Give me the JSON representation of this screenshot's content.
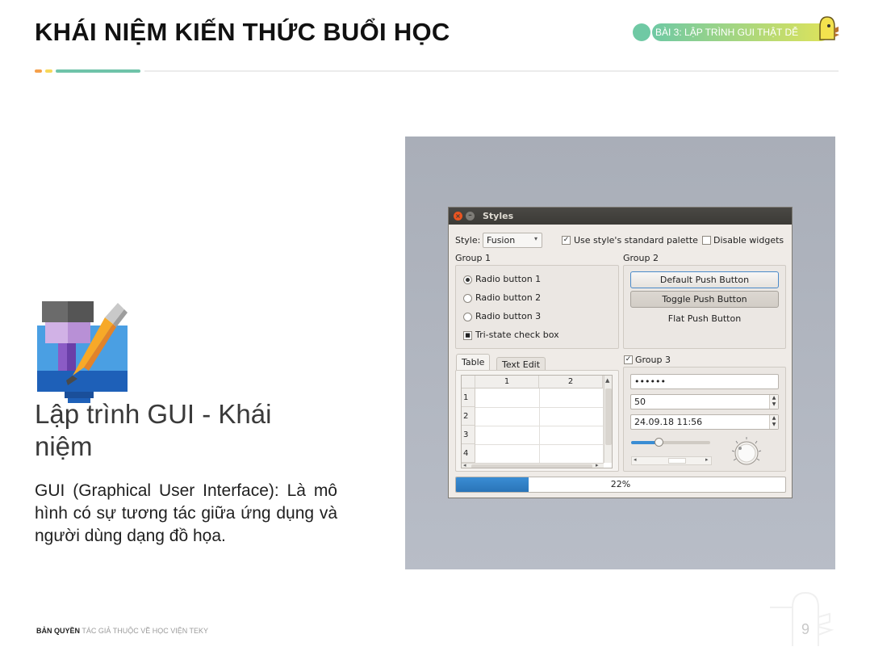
{
  "header": {
    "title": "KHÁI NIỆM KIẾN THỨC BUỔI HỌC",
    "lesson_badge": "BÀI 3: LẬP TRÌNH GUI THẬT DỄ",
    "colors": {
      "orange": "#f5a04b",
      "yellow": "#f7d85a",
      "teal": "#6fc3a9",
      "badge_start": "#6fc9a4",
      "badge_end": "#dfe35a"
    }
  },
  "content": {
    "heading": "Lập trình GUI - Khái niệm",
    "description": "GUI (Graphical User Interface): Là mô hình  có sự tương tác giữa ứng dụng và người dùng dạng đồ họa."
  },
  "styles_window": {
    "title": "Styles",
    "close_glyph": "×",
    "minimize_glyph": "–",
    "style_label": "Style:",
    "style_value": "Fusion",
    "use_palette_label": "Use style's standard palette",
    "use_palette_checked": true,
    "disable_widgets_label": "Disable widgets",
    "disable_widgets_checked": false,
    "group1": {
      "title": "Group 1",
      "radios": [
        "Radio button 1",
        "Radio button 2",
        "Radio button 3"
      ],
      "selected_radio": "Radio button 1",
      "tristate_label": "Tri-state check box"
    },
    "group2": {
      "title": "Group 2",
      "default_button": "Default Push Button",
      "toggle_button": "Toggle Push Button",
      "flat_button": "Flat Push Button"
    },
    "tabs": [
      "Table",
      "Text Edit"
    ],
    "active_tab": "Table",
    "table": {
      "columns": [
        "1",
        "2"
      ],
      "rows": [
        "1",
        "2",
        "3",
        "4"
      ]
    },
    "group3": {
      "title": "Group 3",
      "checked": true,
      "password_value": "••••••",
      "spin_value": "50",
      "datetime_value": "24.09.18 11:56",
      "slider_fraction": 0.35,
      "scrollbar_fraction": 0.62
    },
    "progress": {
      "text": "22%",
      "value": 0.22
    }
  },
  "footer": {
    "copyright_bold": "BẢN QUYỀN",
    "copyright_rest": " TÁC GIẢ THUỘC VỀ HỌC VIỆN TEKY",
    "page_number": "9"
  }
}
